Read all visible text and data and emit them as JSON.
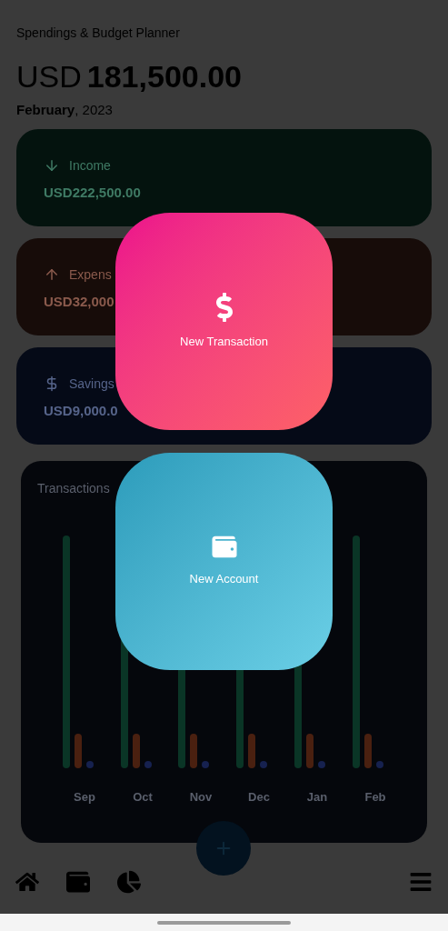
{
  "app_title": "Spendings & Budget Planner",
  "balance": {
    "currency": "USD",
    "amount": "181,500.00"
  },
  "period": {
    "month": "February",
    "year": ", 2023"
  },
  "cards": [
    {
      "kind": "income",
      "label": "Income",
      "amount": "USD222,500.00"
    },
    {
      "kind": "expense",
      "label": "Expens",
      "amount": "USD32,000"
    },
    {
      "kind": "savings",
      "label": "Savings",
      "amount": "USD9,000.0"
    }
  ],
  "transactions": {
    "title": "Transactions",
    "months": [
      "Sep",
      "Oct",
      "Nov",
      "Dec",
      "Jan",
      "Feb"
    ]
  },
  "actions": [
    {
      "kind": "transaction",
      "label": "New Transaction"
    },
    {
      "kind": "account",
      "label": "New Account"
    }
  ],
  "nav": [
    {
      "kind": "home"
    },
    {
      "kind": "wallet"
    },
    {
      "kind": "chart"
    },
    {
      "kind": "menu"
    }
  ]
}
